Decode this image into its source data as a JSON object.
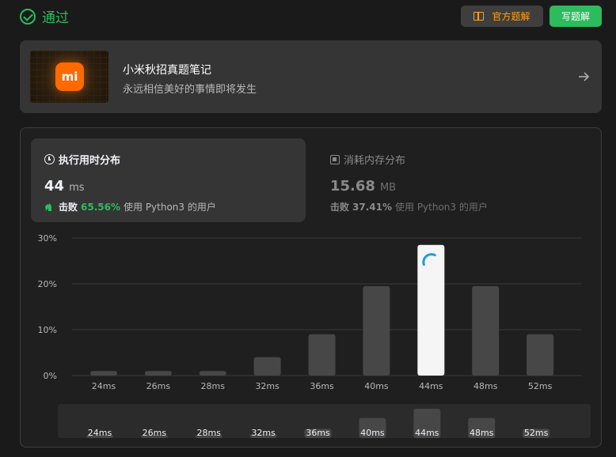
{
  "header": {
    "status": "通过",
    "official_solution_label": "官方题解",
    "write_solution_label": "写题解"
  },
  "promo": {
    "logo_text": "mi",
    "title": "小米秋招真题笔记",
    "subtitle": "永远相信美好的事情即将发生"
  },
  "runtime": {
    "label": "执行用时分布",
    "value": "44",
    "unit": "ms",
    "beats_label": "击败",
    "beats_pct": "65.56%",
    "beats_suffix": "使用 Python3 的用户"
  },
  "memory": {
    "label": "消耗内存分布",
    "value": "15.68",
    "unit": "MB",
    "beats_label": "击败",
    "beats_pct": "37.41%",
    "beats_suffix": "使用 Python3 的用户"
  },
  "colors": {
    "accent_green": "#2cbb5d",
    "accent_orange": "#ffa116",
    "bar": "#474747",
    "bar_highlight": "#f5f5f5"
  },
  "chart_data": {
    "type": "bar",
    "categories": [
      "24ms",
      "26ms",
      "28ms",
      "32ms",
      "36ms",
      "40ms",
      "44ms",
      "48ms",
      "52ms"
    ],
    "values": [
      1,
      1,
      1,
      4,
      9,
      19.5,
      28.5,
      19.5,
      9
    ],
    "highlight_category": "44ms",
    "y_ticks": [
      "0%",
      "10%",
      "20%",
      "30%"
    ],
    "ylim": [
      0,
      30
    ],
    "grid": true
  }
}
